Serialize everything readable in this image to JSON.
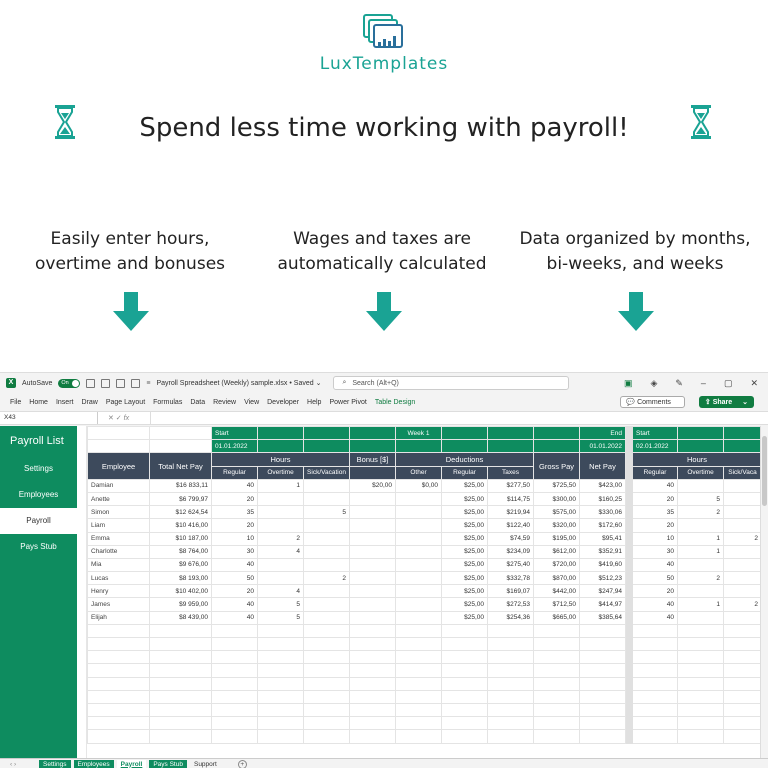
{
  "brand": {
    "name": "LuxTemplates",
    "color": "#1aa394"
  },
  "headline": "Spend less time working with payroll!",
  "features": [
    {
      "line1": "Easily enter hours,",
      "line2": "overtime and bonuses"
    },
    {
      "line1": "Wages and taxes are",
      "line2": "automatically calculated"
    },
    {
      "line1": "Data organized by months,",
      "line2": "bi-weeks, and weeks"
    }
  ],
  "excel": {
    "autosave_label": "AutoSave",
    "autosave_state": "On",
    "file_title": "Payroll Spreadsheet (Weekly) sample.xlsx • Saved ⌄",
    "search_placeholder": "Search (Alt+Q)",
    "menu": [
      "File",
      "Home",
      "Insert",
      "Draw",
      "Page Layout",
      "Formulas",
      "Data",
      "Review",
      "View",
      "Developer",
      "Help",
      "Power Pivot"
    ],
    "menu_active": "Table Design",
    "comments_label": "Comments",
    "share_label": "Share",
    "namebox": "X43",
    "fx": "fx",
    "accent": "#0e8c5f",
    "header_dark": "#3d4a5c",
    "sidebar": {
      "title": "Payroll List",
      "items": [
        "Settings",
        "Employees",
        "Payroll",
        "Pays Stub"
      ],
      "active": "Payroll"
    },
    "week": {
      "start_label": "Start",
      "start_date": "01.01.2022",
      "week_label": "Week 1",
      "end_label": "End",
      "end_date": "01.01.2022",
      "next_start_label": "Start",
      "next_start_date": "02.01.2022"
    },
    "headers": {
      "employee": "Employee",
      "total_net_pay": "Total Net Pay",
      "hours": "Hours",
      "bonus": "Bonus [$]",
      "deductions": "Deductions",
      "gross_pay": "Gross Pay",
      "net_pay": "Net Pay",
      "regular": "Regular",
      "overtime": "Overtime",
      "sick": "Sick/Vacation",
      "other": "Other",
      "ded_regular": "Regular",
      "taxes": "Taxes",
      "w2_hours": "Hours",
      "w2_regular": "Regular",
      "w2_overtime": "Overtime",
      "w2_sick": "Sick/Vaca"
    },
    "rows": [
      {
        "name": "Damian",
        "total": "$16 833,11",
        "reg": "40",
        "ot": "1",
        "sick": "",
        "bonus": "$20,00",
        "other": "$0,00",
        "dreg": "$25,00",
        "tax": "$277,50",
        "gross": "$725,50",
        "net": "$423,00",
        "w2reg": "40",
        "w2ot": "",
        "w2sick": ""
      },
      {
        "name": "Anette",
        "total": "$6 799,97",
        "reg": "20",
        "ot": "",
        "sick": "",
        "bonus": "",
        "other": "",
        "dreg": "$25,00",
        "tax": "$114,75",
        "gross": "$300,00",
        "net": "$160,25",
        "w2reg": "20",
        "w2ot": "5",
        "w2sick": ""
      },
      {
        "name": "Simon",
        "total": "$12 624,54",
        "reg": "35",
        "ot": "",
        "sick": "5",
        "bonus": "",
        "other": "",
        "dreg": "$25,00",
        "tax": "$219,94",
        "gross": "$575,00",
        "net": "$330,06",
        "w2reg": "35",
        "w2ot": "2",
        "w2sick": ""
      },
      {
        "name": "Liam",
        "total": "$10 416,00",
        "reg": "20",
        "ot": "",
        "sick": "",
        "bonus": "",
        "other": "",
        "dreg": "$25,00",
        "tax": "$122,40",
        "gross": "$320,00",
        "net": "$172,60",
        "w2reg": "20",
        "w2ot": "",
        "w2sick": ""
      },
      {
        "name": "Emma",
        "total": "$10 187,00",
        "reg": "10",
        "ot": "2",
        "sick": "",
        "bonus": "",
        "other": "",
        "dreg": "$25,00",
        "tax": "$74,59",
        "gross": "$195,00",
        "net": "$95,41",
        "w2reg": "10",
        "w2ot": "1",
        "w2sick": "2"
      },
      {
        "name": "Charlotte",
        "total": "$8 764,00",
        "reg": "30",
        "ot": "4",
        "sick": "",
        "bonus": "",
        "other": "",
        "dreg": "$25,00",
        "tax": "$234,09",
        "gross": "$612,00",
        "net": "$352,91",
        "w2reg": "30",
        "w2ot": "1",
        "w2sick": ""
      },
      {
        "name": "Mia",
        "total": "$9 676,00",
        "reg": "40",
        "ot": "",
        "sick": "",
        "bonus": "",
        "other": "",
        "dreg": "$25,00",
        "tax": "$275,40",
        "gross": "$720,00",
        "net": "$419,60",
        "w2reg": "40",
        "w2ot": "",
        "w2sick": ""
      },
      {
        "name": "Lucas",
        "total": "$8 193,00",
        "reg": "50",
        "ot": "",
        "sick": "2",
        "bonus": "",
        "other": "",
        "dreg": "$25,00",
        "tax": "$332,78",
        "gross": "$870,00",
        "net": "$512,23",
        "w2reg": "50",
        "w2ot": "2",
        "w2sick": ""
      },
      {
        "name": "Henry",
        "total": "$10 402,00",
        "reg": "20",
        "ot": "4",
        "sick": "",
        "bonus": "",
        "other": "",
        "dreg": "$25,00",
        "tax": "$169,07",
        "gross": "$442,00",
        "net": "$247,94",
        "w2reg": "20",
        "w2ot": "",
        "w2sick": ""
      },
      {
        "name": "James",
        "total": "$9 959,00",
        "reg": "40",
        "ot": "5",
        "sick": "",
        "bonus": "",
        "other": "",
        "dreg": "$25,00",
        "tax": "$272,53",
        "gross": "$712,50",
        "net": "$414,97",
        "w2reg": "40",
        "w2ot": "1",
        "w2sick": "2"
      },
      {
        "name": "Elijah",
        "total": "$8 439,00",
        "reg": "40",
        "ot": "5",
        "sick": "",
        "bonus": "",
        "other": "",
        "dreg": "$25,00",
        "tax": "$254,36",
        "gross": "$665,00",
        "net": "$385,64",
        "w2reg": "40",
        "w2ot": "",
        "w2sick": ""
      }
    ],
    "sheet_tabs": [
      "Settings",
      "Employees",
      "Payroll",
      "Pays Stub",
      "Support"
    ],
    "active_tab": "Payroll"
  }
}
